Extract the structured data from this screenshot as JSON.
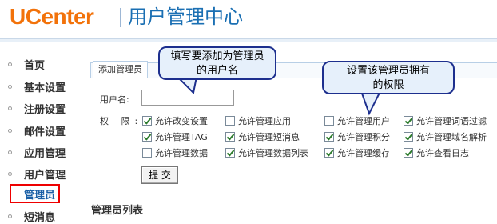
{
  "header": {
    "logo": "UCenter",
    "app_title": "用户管理中心"
  },
  "sidebar": {
    "items": [
      {
        "label": "首页"
      },
      {
        "label": "基本设置"
      },
      {
        "label": "注册设置"
      },
      {
        "label": "邮件设置"
      },
      {
        "label": "应用管理"
      },
      {
        "label": "用户管理"
      },
      {
        "label": "管理员",
        "active": true
      },
      {
        "label": "短消息"
      }
    ]
  },
  "main": {
    "tab_label": "添加管理员",
    "username_label": "用户名:",
    "username_value": "",
    "permissions_label": "权 限:",
    "permissions": [
      {
        "label": "允许改变设置",
        "checked": true
      },
      {
        "label": "允许管理应用",
        "checked": false
      },
      {
        "label": "允许管理用户",
        "checked": false
      },
      {
        "label": "允许管理词语过滤",
        "checked": true
      },
      {
        "label": "允许管理TAG",
        "checked": true
      },
      {
        "label": "允许管理短消息",
        "checked": true
      },
      {
        "label": "允许管理积分",
        "checked": true
      },
      {
        "label": "允许管理域名解析",
        "checked": true
      },
      {
        "label": "允许管理数据",
        "checked": false
      },
      {
        "label": "允许管理数据列表",
        "checked": true
      },
      {
        "label": "允许管理缓存",
        "checked": true
      },
      {
        "label": "允许查看日志",
        "checked": true
      }
    ],
    "submit_label": "提 交",
    "list_title": "管理员列表"
  },
  "callouts": {
    "username_hint": "填写要添加为管理员的用户名",
    "permissions_hint": "设置该管理员拥有的权限"
  },
  "colors": {
    "logo": "#f2720a",
    "title": "#1a6fb3",
    "callout_border": "#1d2f8e",
    "callout_fill": "#e6f0fb",
    "active_border": "#ee0000"
  }
}
